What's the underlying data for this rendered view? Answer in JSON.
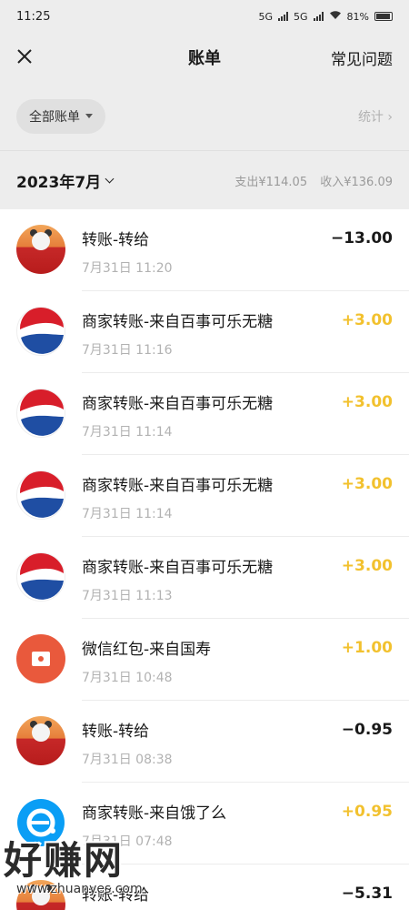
{
  "status_bar": {
    "time": "11:25",
    "network1": "5G",
    "network2": "5G",
    "battery": "81%"
  },
  "nav": {
    "title": "账单",
    "faq_label": "常见问题"
  },
  "filter": {
    "label": "全部账单",
    "stats_label": "统计"
  },
  "month": {
    "label": "2023年7月",
    "expense": "支出¥114.05",
    "income": "收入¥136.09"
  },
  "colors": {
    "income_amount": "#f2c12e",
    "background": "#ededed"
  },
  "transactions": [
    {
      "icon": "person-avatar",
      "title": "转账-转给",
      "time": "7月31日 11:20",
      "amount": "−13.00",
      "type": "out"
    },
    {
      "icon": "pepsi-logo",
      "title": "商家转账-来自百事可乐无糖",
      "time": "7月31日 11:16",
      "amount": "+3.00",
      "type": "in"
    },
    {
      "icon": "pepsi-logo",
      "title": "商家转账-来自百事可乐无糖",
      "time": "7月31日 11:14",
      "amount": "+3.00",
      "type": "in"
    },
    {
      "icon": "pepsi-logo",
      "title": "商家转账-来自百事可乐无糖",
      "time": "7月31日 11:14",
      "amount": "+3.00",
      "type": "in"
    },
    {
      "icon": "pepsi-logo",
      "title": "商家转账-来自百事可乐无糖",
      "time": "7月31日 11:13",
      "amount": "+3.00",
      "type": "in"
    },
    {
      "icon": "red-packet-icon",
      "title": "微信红包-来自国寿",
      "time": "7月31日 10:48",
      "amount": "+1.00",
      "type": "in"
    },
    {
      "icon": "person-avatar",
      "title": "转账-转给",
      "time": "7月31日 08:38",
      "amount": "−0.95",
      "type": "out"
    },
    {
      "icon": "eleme-logo",
      "title": "商家转账-来自饿了么",
      "time": "7月31日 07:48",
      "amount": "+0.95",
      "type": "in"
    },
    {
      "icon": "person-avatar",
      "title": "转账-转给",
      "time": "",
      "amount": "−5.31",
      "type": "out"
    }
  ],
  "watermark": {
    "main": "好赚网",
    "url": "www.zhuanyes.com"
  }
}
